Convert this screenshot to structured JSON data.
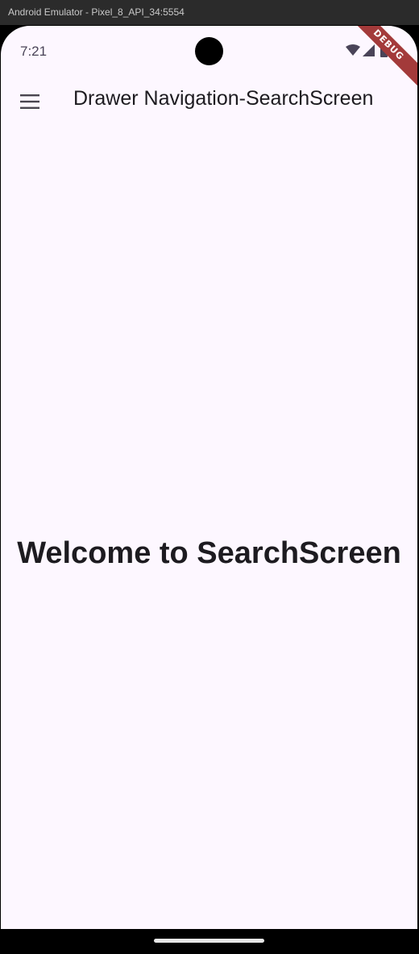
{
  "window": {
    "title": "Android Emulator - Pixel_8_API_34:5554"
  },
  "status_bar": {
    "time": "7:21",
    "icons": [
      "wifi-icon",
      "signal-icon",
      "battery-icon"
    ]
  },
  "debug_banner": {
    "label": "DEBUG",
    "color": "#a33a3a"
  },
  "app_bar": {
    "title": "Drawer Navigation-SearchScreen",
    "menu_icon": "menu-icon"
  },
  "body": {
    "welcome_text": "Welcome to SearchScreen"
  },
  "colors": {
    "background": "#fdf7ff",
    "text": "#1d1b20"
  }
}
